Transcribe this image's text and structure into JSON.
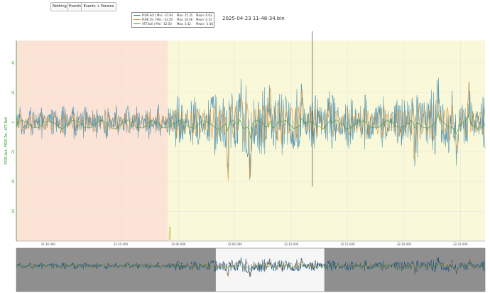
{
  "toolbar": {
    "buttons": [
      "Nothing",
      "Events",
      "Events + Params"
    ]
  },
  "file_title": "2025-04-23 11-48-34.bin",
  "legend": [
    {
      "name": "PIDR.Act",
      "min": "Min: -37.94",
      "max": "Max: 25.35",
      "mean": "Mean: 0.03",
      "color": "#3b6e9c"
    },
    {
      "name": "PIDR.Tar",
      "min": "Min: -32.29",
      "max": "Max: 26.66",
      "mean": "Mean: 0.33",
      "color": "#e3933a"
    },
    {
      "name": "ATT.Roll",
      "min": "Min: -12.50",
      "max": "Max: 3.42",
      "mean": "Mean: -1.46",
      "color": "#3d9c45"
    }
  ],
  "colors": {
    "act": "#3b6e9c",
    "act_fill": "#4a90b0",
    "tar": "#e3933a",
    "roll": "#3d9c45",
    "mode_a": "#fbe3d5",
    "mode_b": "#f9f8d9",
    "overview_bg": "#8f8f8f"
  },
  "chart_data": {
    "type": "line",
    "title": "",
    "ylabel": "PIDR.Act, PIDR.Tar, ATT.Roll",
    "xlabel": "",
    "x_tick_labels": [
      "31:30.000",
      "31:35.000",
      "32:00.000",
      "32:05.000",
      "32:10.000",
      "32:15.000",
      "32:20.000",
      "32:25.000"
    ],
    "y_tick_labels": [
      "40",
      "20",
      "0",
      "-20",
      "-40",
      "-60"
    ],
    "ylim": [
      -80,
      55
    ],
    "xlim": [
      0,
      66.5
    ],
    "mode_events": [
      {
        "label": "",
        "start": 0,
        "end": 21.5
      },
      {
        "label": "Autotune",
        "start": 21.5,
        "end": 66.5
      }
    ],
    "cursor_x": 42,
    "overview_window": [
      28.3,
      43.7
    ],
    "series": [
      {
        "name": "PIDR.Act",
        "color": "#3b6e9c",
        "min": -37.94,
        "max": 25.35,
        "mean": 0.03
      },
      {
        "name": "PIDR.Tar",
        "color": "#e3933a",
        "min": -32.29,
        "max": 26.66,
        "mean": 0.33
      },
      {
        "name": "ATT.Roll",
        "color": "#3d9c45",
        "min": -12.5,
        "max": 3.42,
        "mean": -1.46
      }
    ]
  }
}
